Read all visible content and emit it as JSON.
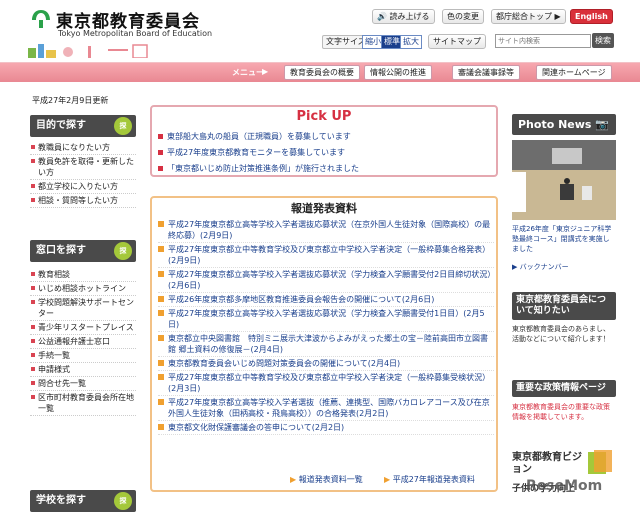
{
  "header": {
    "title": "東京都教育委員会",
    "subtitle": "Tokyo Metropolitan Board of Education",
    "read_aloud": "読み上げる",
    "color_change": "色の変更",
    "office_top": "都庁総合トップ",
    "english": "English",
    "font_size_label": "文字サイズ",
    "font_small": "縮小",
    "font_standard": "標準",
    "font_large": "拡大",
    "sitemap": "サイトマップ",
    "search_placeholder": "サイト内検索",
    "search_button": "検索"
  },
  "menu": {
    "label": "メニュー",
    "items": [
      "教育委員会の概要",
      "情報公開の推進",
      "審議会議事録等",
      "関連ホームページ"
    ]
  },
  "updated": "平成27年2月9日更新",
  "sidebar": {
    "section1": {
      "title": "目的で探す",
      "items": [
        "教職員になりたい方",
        "教員免許を取得・更新したい方",
        "都立学校に入りたい方",
        "相談・質問等したい方"
      ]
    },
    "section2": {
      "title": "窓口を探す",
      "items": [
        "教育相談",
        "いじめ相談ホットライン",
        "学校問題解決サポートセンター",
        "青少年リスタートプレイス",
        "公益通報弁護士窓口",
        "手続一覧",
        "申請様式",
        "問合せ先一覧",
        "区市町村教育委員会所在地一覧"
      ]
    },
    "section3": {
      "title": "学校を探す"
    }
  },
  "pickup": {
    "title": "Pick UP",
    "items": [
      "東部船大島丸の船員（正規職員）を募集しています",
      "平成27年度東京都教育モニターを募集しています",
      "「東京都いじめ防止対策推進条例」が施行されました"
    ]
  },
  "news": {
    "title": "報道発表資料",
    "items": [
      "平成27年度東京都立高等学校入学者選抜応募状況（在京外国人生徒対象（国際高校）の最終応募）(2月9日)",
      "平成27年度東京都立中等教育学校及び東京都立中学校入学者決定（一般枠募集合格発表）(2月9日)",
      "平成27年度東京都立高等学校入学者選抜応募状況（学力検査入学願書受付2日目締切状況）(2月6日)",
      "平成26年度東京都多摩地区教育推進委員会報告会の開催について(2月6日)",
      "平成27年度東京都立高等学校入学者選抜応募状況（学力検査入学願書受付1日目）(2月5日)",
      "東京都立中央図書館　特別ミニ展示大津波からよみがえった郷土の宝－陸前高田市立図書館 郷土資料の修復展－(2月4日)",
      "東京都教育委員会いじめ問題対策委員会の開催について(2月4日)",
      "平成27年度東京都立中等教育学校及び東京都立中学校入学者決定（一般枠募集受検状況）(2月3日)",
      "平成27年度東京都立高等学校入学者選抜（推薦、連携型、国際バカロレアコース及び在京外国人生徒対象（田柄高校・飛鳥高校））の合格発表(2月2日)",
      "東京都文化財保護審議会の答申について(2月2日)"
    ],
    "link_list": "報道発表資料一覧",
    "link_year": "平成27年報道発表資料"
  },
  "right": {
    "photo_title": "Photo News",
    "photo_caption": "平成26年度「東京ジュニア科学塾最終コース」閉講式を実施しました",
    "photo_more": "バックナンバー",
    "about_title": "東京都教育委員会について知りたい",
    "about_text": "東京都教育委員会のあらまし、活動などについて紹介します！",
    "policy_title": "重要な政策情報ページ",
    "policy_text": "東京都教育委員会の重要な政策情報を掲載しています。",
    "vision_title": "東京都教育ビジョン",
    "vision_sub": "子供の学力向上"
  },
  "watermark": "ReseMom",
  "colors": {
    "accent_pink": "#e98892",
    "news_orange": "#f0a030",
    "pick_red": "#d63042"
  }
}
